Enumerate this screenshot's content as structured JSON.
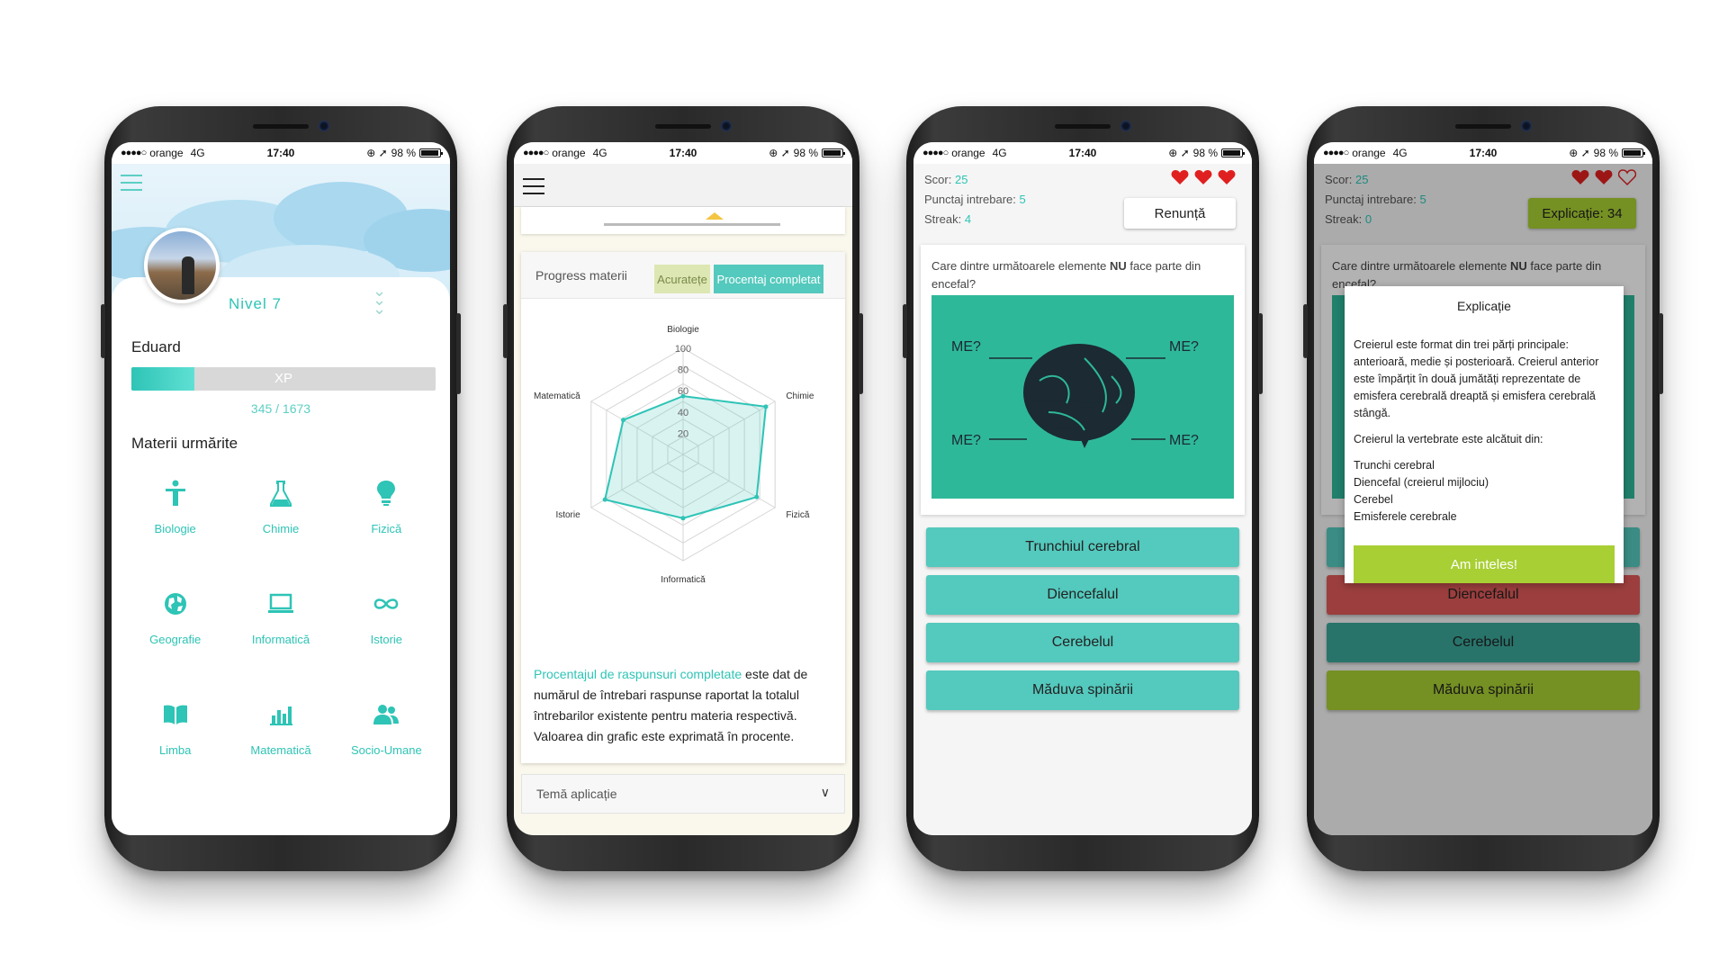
{
  "status": {
    "carrier": "orange",
    "network": "4G",
    "time": "17:40",
    "battery": "98 %"
  },
  "profile": {
    "level": "Nivel 7",
    "name": "Eduard",
    "xp_label": "XP",
    "xp_text": "345 / 1673",
    "xp_fraction": 0.206,
    "section_title": "Materii urmărite",
    "subjects": [
      {
        "label": "Biologie",
        "icon": "person-icon"
      },
      {
        "label": "Chimie",
        "icon": "flask-icon"
      },
      {
        "label": "Fizică",
        "icon": "bulb-icon"
      },
      {
        "label": "Geografie",
        "icon": "globe-icon"
      },
      {
        "label": "Informatică",
        "icon": "laptop-icon"
      },
      {
        "label": "Istorie",
        "icon": "infinity-icon"
      },
      {
        "label": "Limba",
        "icon": "book-icon"
      },
      {
        "label": "Matematică",
        "icon": "bar-chart-icon"
      },
      {
        "label": "Socio-Umane",
        "icon": "people-icon"
      }
    ]
  },
  "progress": {
    "card_title": "Progress materii",
    "tab_accuracy": "Acuratețe",
    "tab_completed": "Procentaj completat",
    "description_highlight": "Procentajul de raspunsuri completate",
    "description_rest": " este dat de numărul de întrebari raspunse raportat la totalul întrebarilor existente pentru materia respectivă. Valoarea din grafic este exprimată în procente.",
    "theme_label": "Temă aplicație"
  },
  "chart_data": {
    "type": "radar",
    "categories": [
      "Biologie",
      "Chimie",
      "Fizică",
      "Informatică",
      "Istorie",
      "Matematică"
    ],
    "values": [
      55,
      90,
      80,
      60,
      85,
      65
    ],
    "ticks": [
      "20",
      "40",
      "60",
      "80",
      "100"
    ],
    "rlim": [
      0,
      100
    ]
  },
  "quiz": {
    "score_label": "Scor:",
    "score": "25",
    "points_label": "Punctaj intrebare:",
    "points": "5",
    "streak_label": "Streak:",
    "streak_a": "4",
    "streak_b": "0",
    "quit_button": "Renunță",
    "explain_button": "Explicație: 34",
    "question_pre": "Care dintre următoarele elemente ",
    "question_bold": "NU",
    "question_post": " face parte din encefal?",
    "image_labels": [
      "ME?",
      "ME?",
      "ME?",
      "ME?"
    ],
    "answers": [
      "Trunchiul cerebral",
      "Diencefalul",
      "Cerebelul",
      "Măduva spinării"
    ],
    "answer_colors_feedback": [
      "#54c9bd",
      "#e05a5a",
      "#3aa79a",
      "#a8cf33"
    ],
    "heart_color": "#e02020"
  },
  "explanation": {
    "title": "Explicație",
    "paragraph1": "Creierul este format din trei părți principale: anterioară, medie și posterioară. Creierul anterior este împărțit în două jumătăți reprezentate de emisfera cerebrală dreaptă și emisfera cerebrală stângă.",
    "paragraph2": "Creierul la vertebrate este alcătuit din:",
    "items": [
      "Trunchi cerebral",
      "Diencefal (creierul mijlociu)",
      "Cerebel",
      "Emisferele cerebrale"
    ],
    "ok_button": "Am inteles!"
  }
}
